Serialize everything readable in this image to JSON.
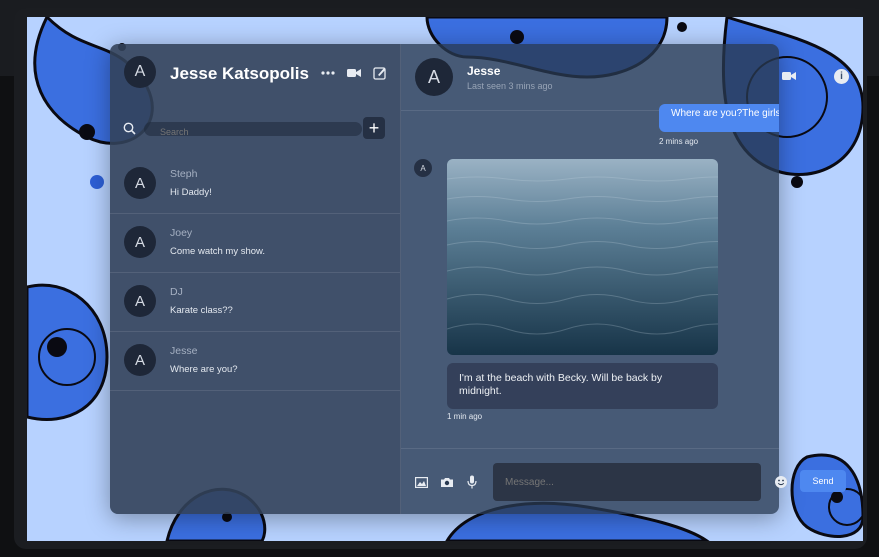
{
  "left_panel": {
    "user_initial": "A",
    "user_name": "Jesse Katsopolis",
    "search_placeholder": "Search",
    "conversations": [
      {
        "initial": "A",
        "name": "Steph",
        "message": "Hi Daddy!"
      },
      {
        "initial": "A",
        "name": "Joey",
        "message": "Come watch my show."
      },
      {
        "initial": "A",
        "name": "DJ",
        "message": "Karate class??"
      },
      {
        "initial": "A",
        "name": "Jesse",
        "message": "Where are you?"
      }
    ]
  },
  "chat": {
    "contact_initial": "A",
    "contact_name": "Jesse",
    "contact_status": "Last seen 3 mins ago",
    "outgoing_message": "Where are you?The girls miss you.",
    "outgoing_time": "2 mins ago",
    "incoming_initial": "A",
    "incoming_caption": "I'm at the beach with Becky. Will be back by midnight.",
    "incoming_time": "1 min ago",
    "message_placeholder": "Message...",
    "send_label": "Send"
  },
  "colors": {
    "accent": "#4e88f0",
    "wallpaper": "#b7d2ff",
    "panel": "#283850"
  },
  "icons": [
    "more-icon",
    "video-icon",
    "compose-icon",
    "search-icon",
    "plus-icon",
    "phone-icon",
    "info-icon",
    "image-icon",
    "camera-icon",
    "mic-icon",
    "emoji-icon"
  ]
}
